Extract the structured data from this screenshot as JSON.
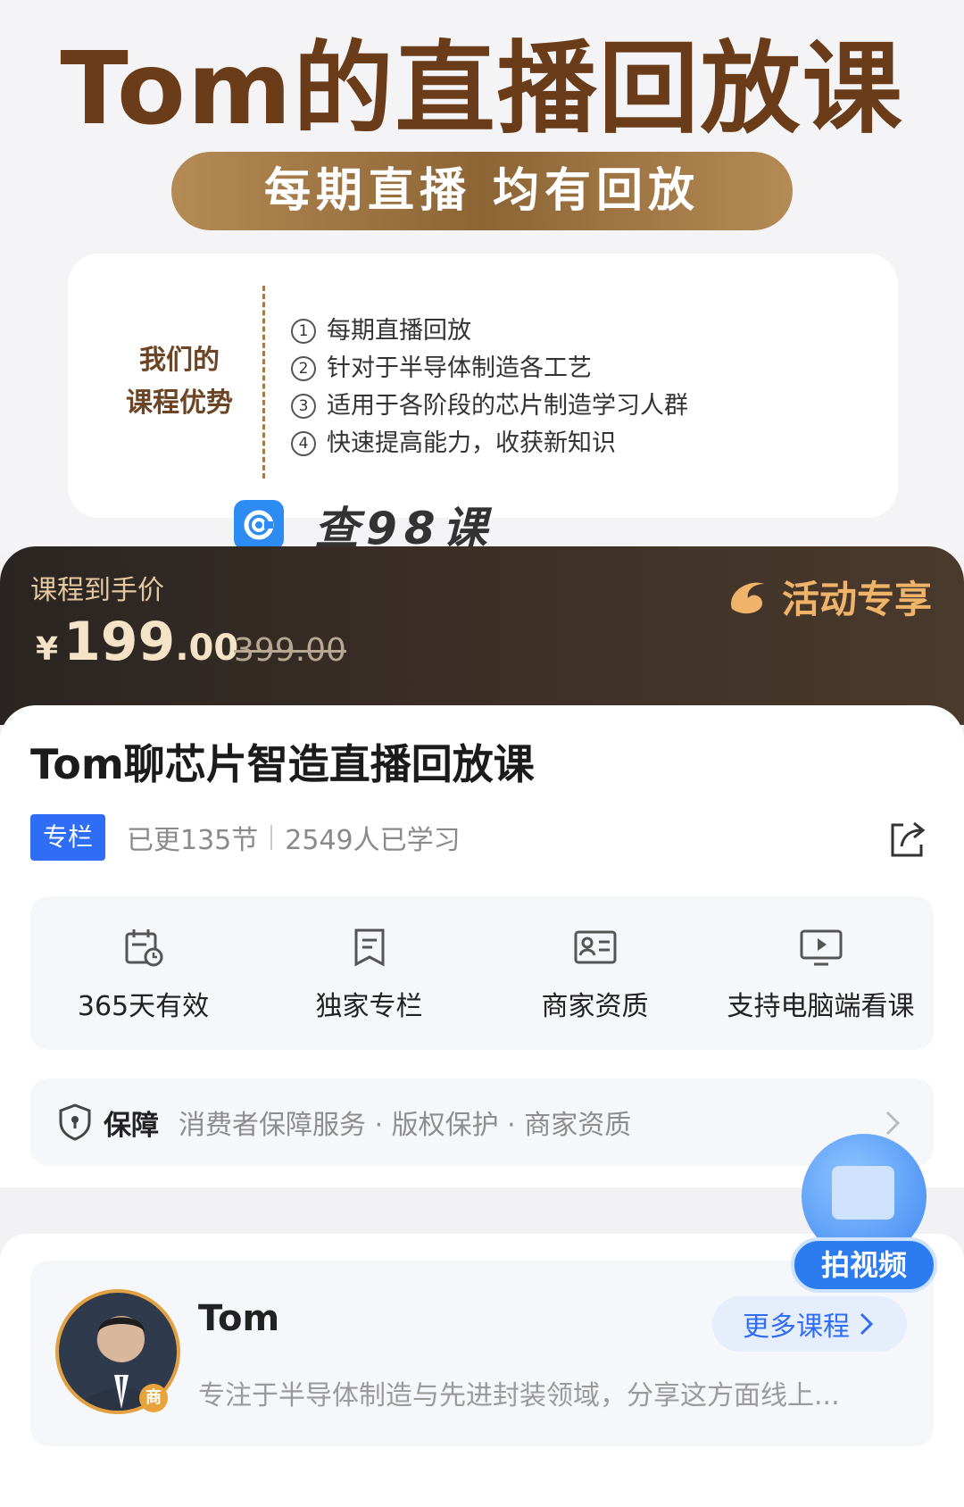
{
  "banner": {
    "title": "Tom的直播回放课",
    "pill": "每期直播 均有回放",
    "advantages_label_line1": "我们的",
    "advantages_label_line2": "课程优势",
    "advantages": [
      {
        "num": "1",
        "text": "每期直播回放"
      },
      {
        "num": "2",
        "text": "针对于半导体制造各工艺"
      },
      {
        "num": "3",
        "text": "适用于各阶段的芯片制造学习人群"
      },
      {
        "num": "4",
        "text": "快速提高能力，收获新知识"
      }
    ]
  },
  "watermark": {
    "text": "查98课"
  },
  "price": {
    "label": "课程到手价",
    "currency": "¥",
    "integer": "199",
    "decimal": ".00",
    "original": "399.00",
    "promo": "活动专享"
  },
  "course": {
    "title": "Tom聊芯片智造直播回放课",
    "tag": "专栏",
    "updated": "已更135节",
    "learners": "2549人已学习"
  },
  "features": [
    {
      "icon": "calendar-clock-icon",
      "label": "365天有效"
    },
    {
      "icon": "bookmark-icon",
      "label": "独家专栏"
    },
    {
      "icon": "id-card-icon",
      "label": "商家资质"
    },
    {
      "icon": "monitor-play-icon",
      "label": "支持电脑端看课"
    }
  ],
  "guarantee": {
    "title": "保障",
    "items": "消费者保障服务 · 版权保护 · 商家资质"
  },
  "float_button": {
    "label": "拍视频"
  },
  "author": {
    "name": "Tom",
    "badge": "商",
    "more_label": "更多课程",
    "description": "专注于半导体制造与先进封装领域，分享这方面线上..."
  }
}
